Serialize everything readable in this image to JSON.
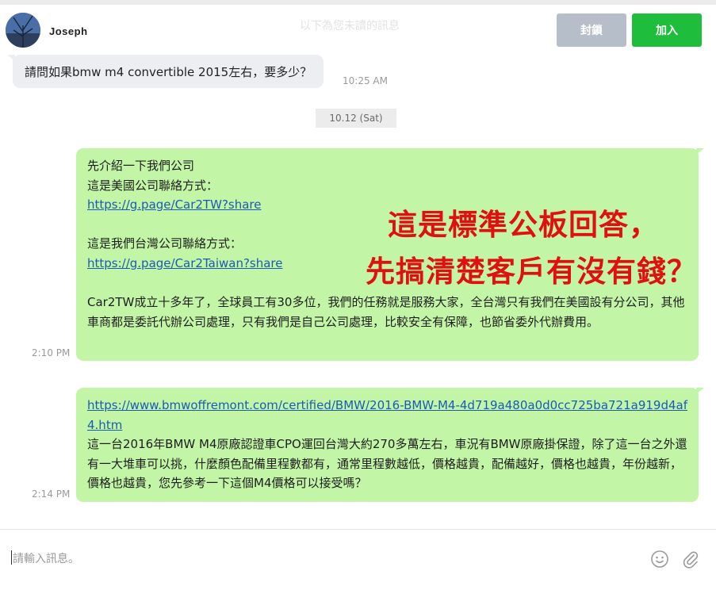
{
  "header": {
    "username": "Joseph",
    "faint_notice": "以下為您未讀的訊息",
    "block_label": "封鎖",
    "add_label": "加入"
  },
  "messages": {
    "incoming": {
      "text": "請問如果bmw m4 convertible 2015左右，要多少？",
      "time": "10:25 AM"
    },
    "date_divider": "10.12 (Sat)",
    "outgoing_1": {
      "line1": "先介紹一下我們公司",
      "line2": "這是美國公司聯絡方式：",
      "link1": "https://g.page/Car2TW?share",
      "line3": "這是我們台灣公司聯絡方式：",
      "link2": "https://g.page/Car2Taiwan?share",
      "paragraph": "Car2TW成立十多年了，全球員工有30多位，我們的任務就是服務大家，全台灣只有我們在美國設有分公司，其他車商都是委託代辦公司處理，只有我們是自己公司處理，比較安全有保障，也節省委外代辦費用。",
      "time": "2:10 PM"
    },
    "outgoing_2": {
      "link": "https://www.bmwoffremont.com/certified/BMW/2016-BMW-M4-4d719a480a0d0cc725ba721a919d4af4.htm",
      "paragraph": "這一台2016年BMW M4原廠認證車CPO運回台灣大約270多萬左右，車況有BMW原廠掛保證，除了這一台之外還有一大堆車可以挑，什麼顏色配備里程數都有，通常里程數越低，價格越貴，配備越好，價格也越貴，年份越新，價格也越貴，您先參考一下這個M4價格可以接受嗎？",
      "time": "2:14 PM"
    }
  },
  "annotation": {
    "line1": "這是標準公板回答，",
    "line2": "先搞清楚客戶有沒有錢？"
  },
  "composer": {
    "placeholder": "請輸入訊息。",
    "emoji_icon": "smiley-icon",
    "attach_icon": "paperclip-icon"
  },
  "colors": {
    "bubble_out": "#c2f5a5",
    "bubble_in": "#edeef2",
    "add_button": "#1ebe3c",
    "block_button": "#b6bfc9",
    "annotation": "#e01010",
    "link": "#1a5bb8"
  }
}
